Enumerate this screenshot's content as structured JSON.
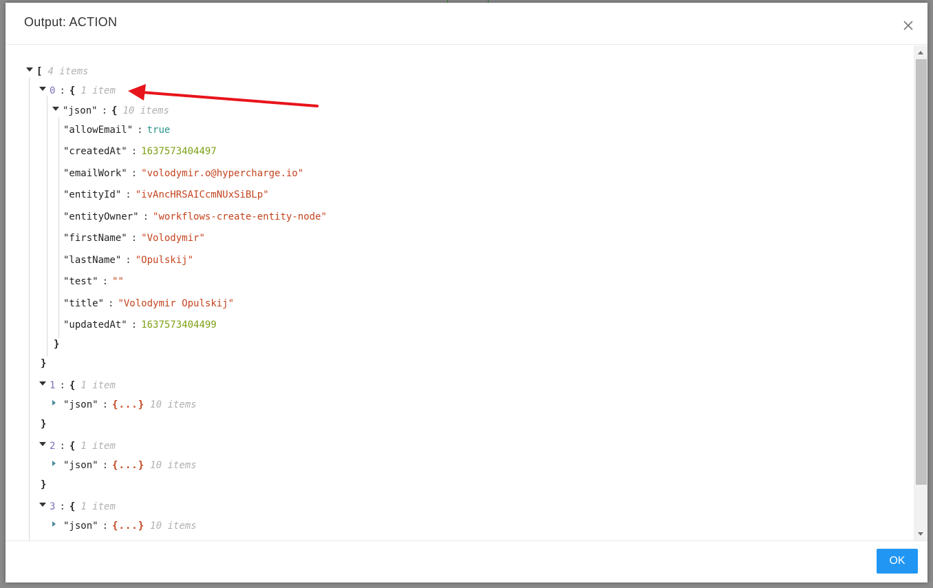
{
  "modal": {
    "title": "Output: ACTION",
    "ok_label": "OK",
    "close_icon": "close-icon"
  },
  "tree": {
    "root": {
      "open": "[",
      "count": "4 items"
    },
    "items": [
      {
        "index": "0",
        "open": "{",
        "close": "}",
        "count": "1 item",
        "json_key": "\"json\"",
        "json_open": "{",
        "json_close": "}",
        "json_count": "10 items",
        "fields": [
          {
            "key": "\"allowEmail\"",
            "value": "true",
            "type": "bool"
          },
          {
            "key": "\"createdAt\"",
            "value": "1637573404497",
            "type": "num"
          },
          {
            "key": "\"emailWork\"",
            "value": "\"volodymir.o@hypercharge.io\"",
            "type": "str"
          },
          {
            "key": "\"entityId\"",
            "value": "\"ivAncHRSAICcmNUxSiBLp\"",
            "type": "str"
          },
          {
            "key": "\"entityOwner\"",
            "value": "\"workflows-create-entity-node\"",
            "type": "str"
          },
          {
            "key": "\"firstName\"",
            "value": "\"Volodymir\"",
            "type": "str"
          },
          {
            "key": "\"lastName\"",
            "value": "\"Opulskij\"",
            "type": "str"
          },
          {
            "key": "\"test\"",
            "value": "\"\"",
            "type": "str"
          },
          {
            "key": "\"title\"",
            "value": "\"Volodymir Opulskij\"",
            "type": "str"
          },
          {
            "key": "\"updatedAt\"",
            "value": "1637573404499",
            "type": "num"
          }
        ]
      },
      {
        "index": "1",
        "open": "{",
        "close": "}",
        "count": "1 item",
        "json_key": "\"json\"",
        "collapsed": "{...}",
        "json_count": "10 items"
      },
      {
        "index": "2",
        "open": "{",
        "close": "}",
        "count": "1 item",
        "json_key": "\"json\"",
        "collapsed": "{...}",
        "json_count": "10 items"
      },
      {
        "index": "3",
        "open": "{",
        "close": "}",
        "count": "1 item",
        "json_key": "\"json\"",
        "collapsed": "{...}",
        "json_count": "10 items"
      }
    ]
  },
  "colors": {
    "string": "#c4441e",
    "number": "#7ca012",
    "boolean": "#27968a",
    "index": "#7a72b8",
    "ok_button": "#2196f3",
    "annotation_arrow": "#e8141b"
  }
}
